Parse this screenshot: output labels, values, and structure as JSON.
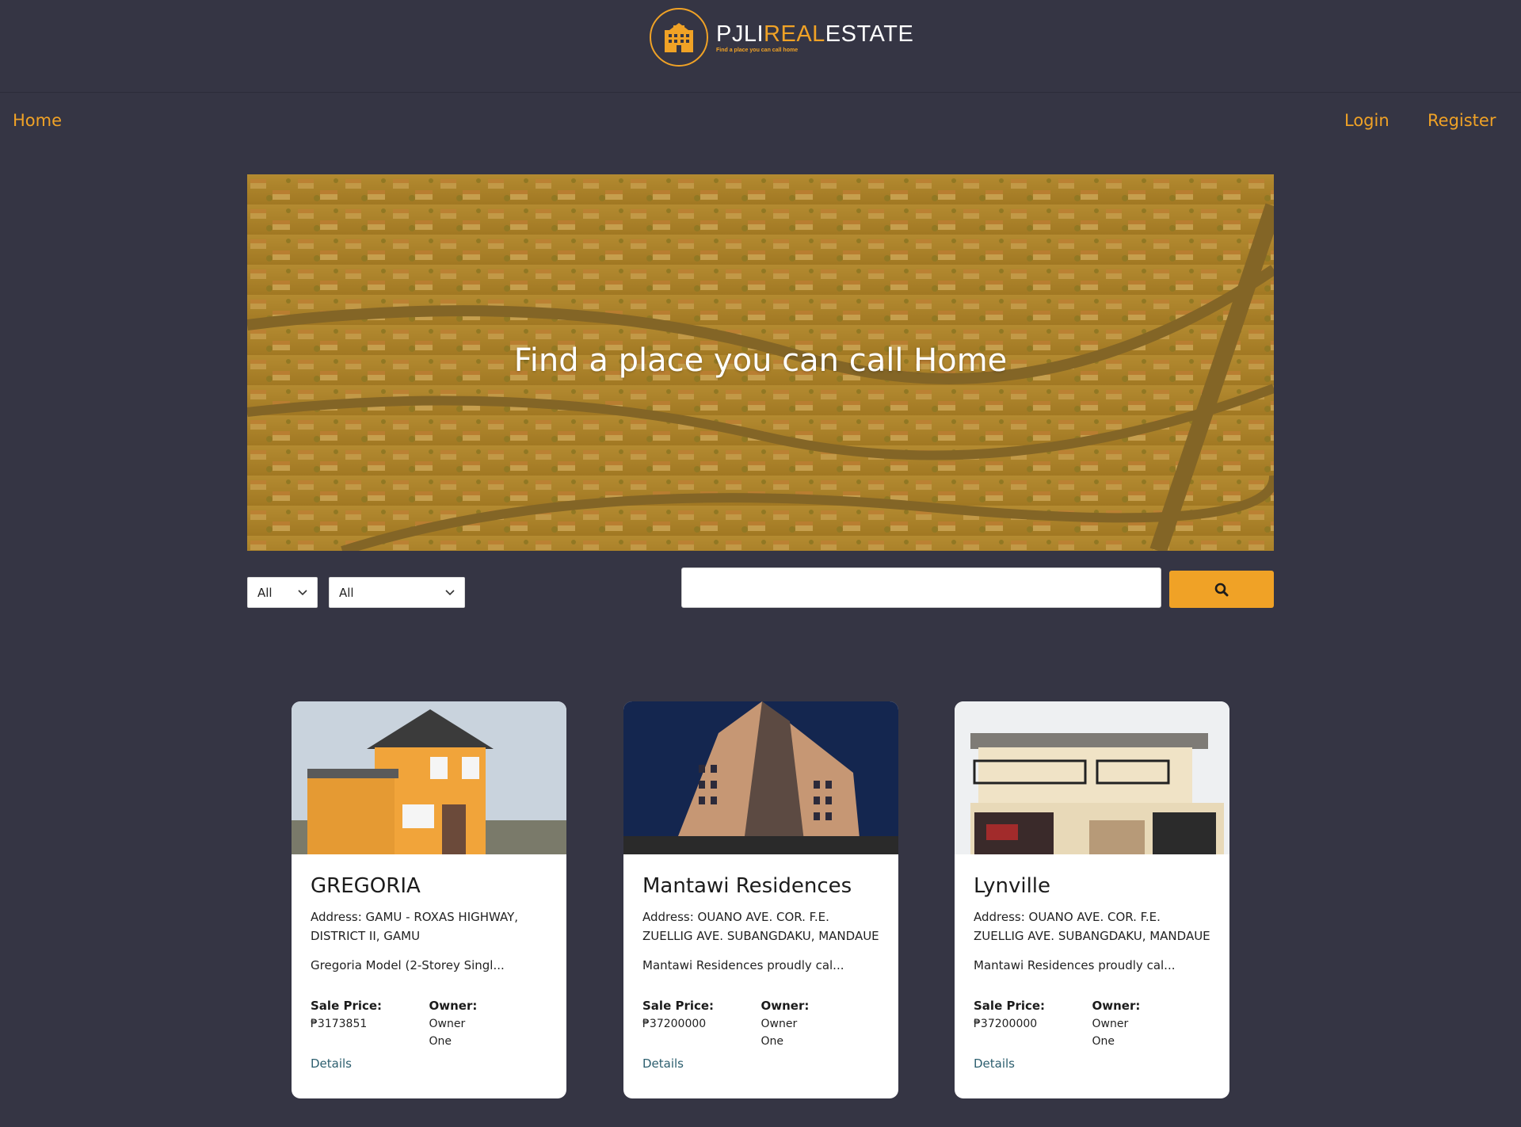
{
  "brand": {
    "name_part1": "PJLI",
    "name_part2": "REAL",
    "name_part3": "ESTATE",
    "tagline": "Find a place you can call home",
    "logo_icon": "building-icon",
    "accent_color": "#f0a226"
  },
  "nav": {
    "home": "Home",
    "login": "Login",
    "register": "Register"
  },
  "hero": {
    "title": "Find a place you can call Home"
  },
  "filters": {
    "filter1_value": "All",
    "filter2_value": "All",
    "chevron_icon": "chevron-down-icon"
  },
  "search": {
    "placeholder": "",
    "value": "",
    "button_icon": "search-icon"
  },
  "properties": [
    {
      "title": "GREGORIA",
      "address": "Address: GAMU - ROXAS HIGHWAY, DISTRICT II, GAMU",
      "description": "Gregoria Model (2-Storey Singl...",
      "price_label": "Sale Price:",
      "price": "₱3173851",
      "owner_label": "Owner:",
      "owner": "Owner One",
      "details_label": "Details"
    },
    {
      "title": "Mantawi Residences",
      "address": "Address: OUANO AVE. COR. F.E. ZUELLIG AVE. SUBANGDAKU, MANDAUE",
      "description": "Mantawi Residences proudly cal...",
      "price_label": "Sale Price:",
      "price": "₱37200000",
      "owner_label": "Owner:",
      "owner": "Owner One",
      "details_label": "Details"
    },
    {
      "title": "Lynville",
      "address": "Address: OUANO AVE. COR. F.E. ZUELLIG AVE. SUBANGDAKU, MANDAUE",
      "description": "Mantawi Residences proudly cal...",
      "price_label": "Sale Price:",
      "price": "₱37200000",
      "owner_label": "Owner:",
      "owner": "Owner One",
      "details_label": "Details"
    }
  ]
}
